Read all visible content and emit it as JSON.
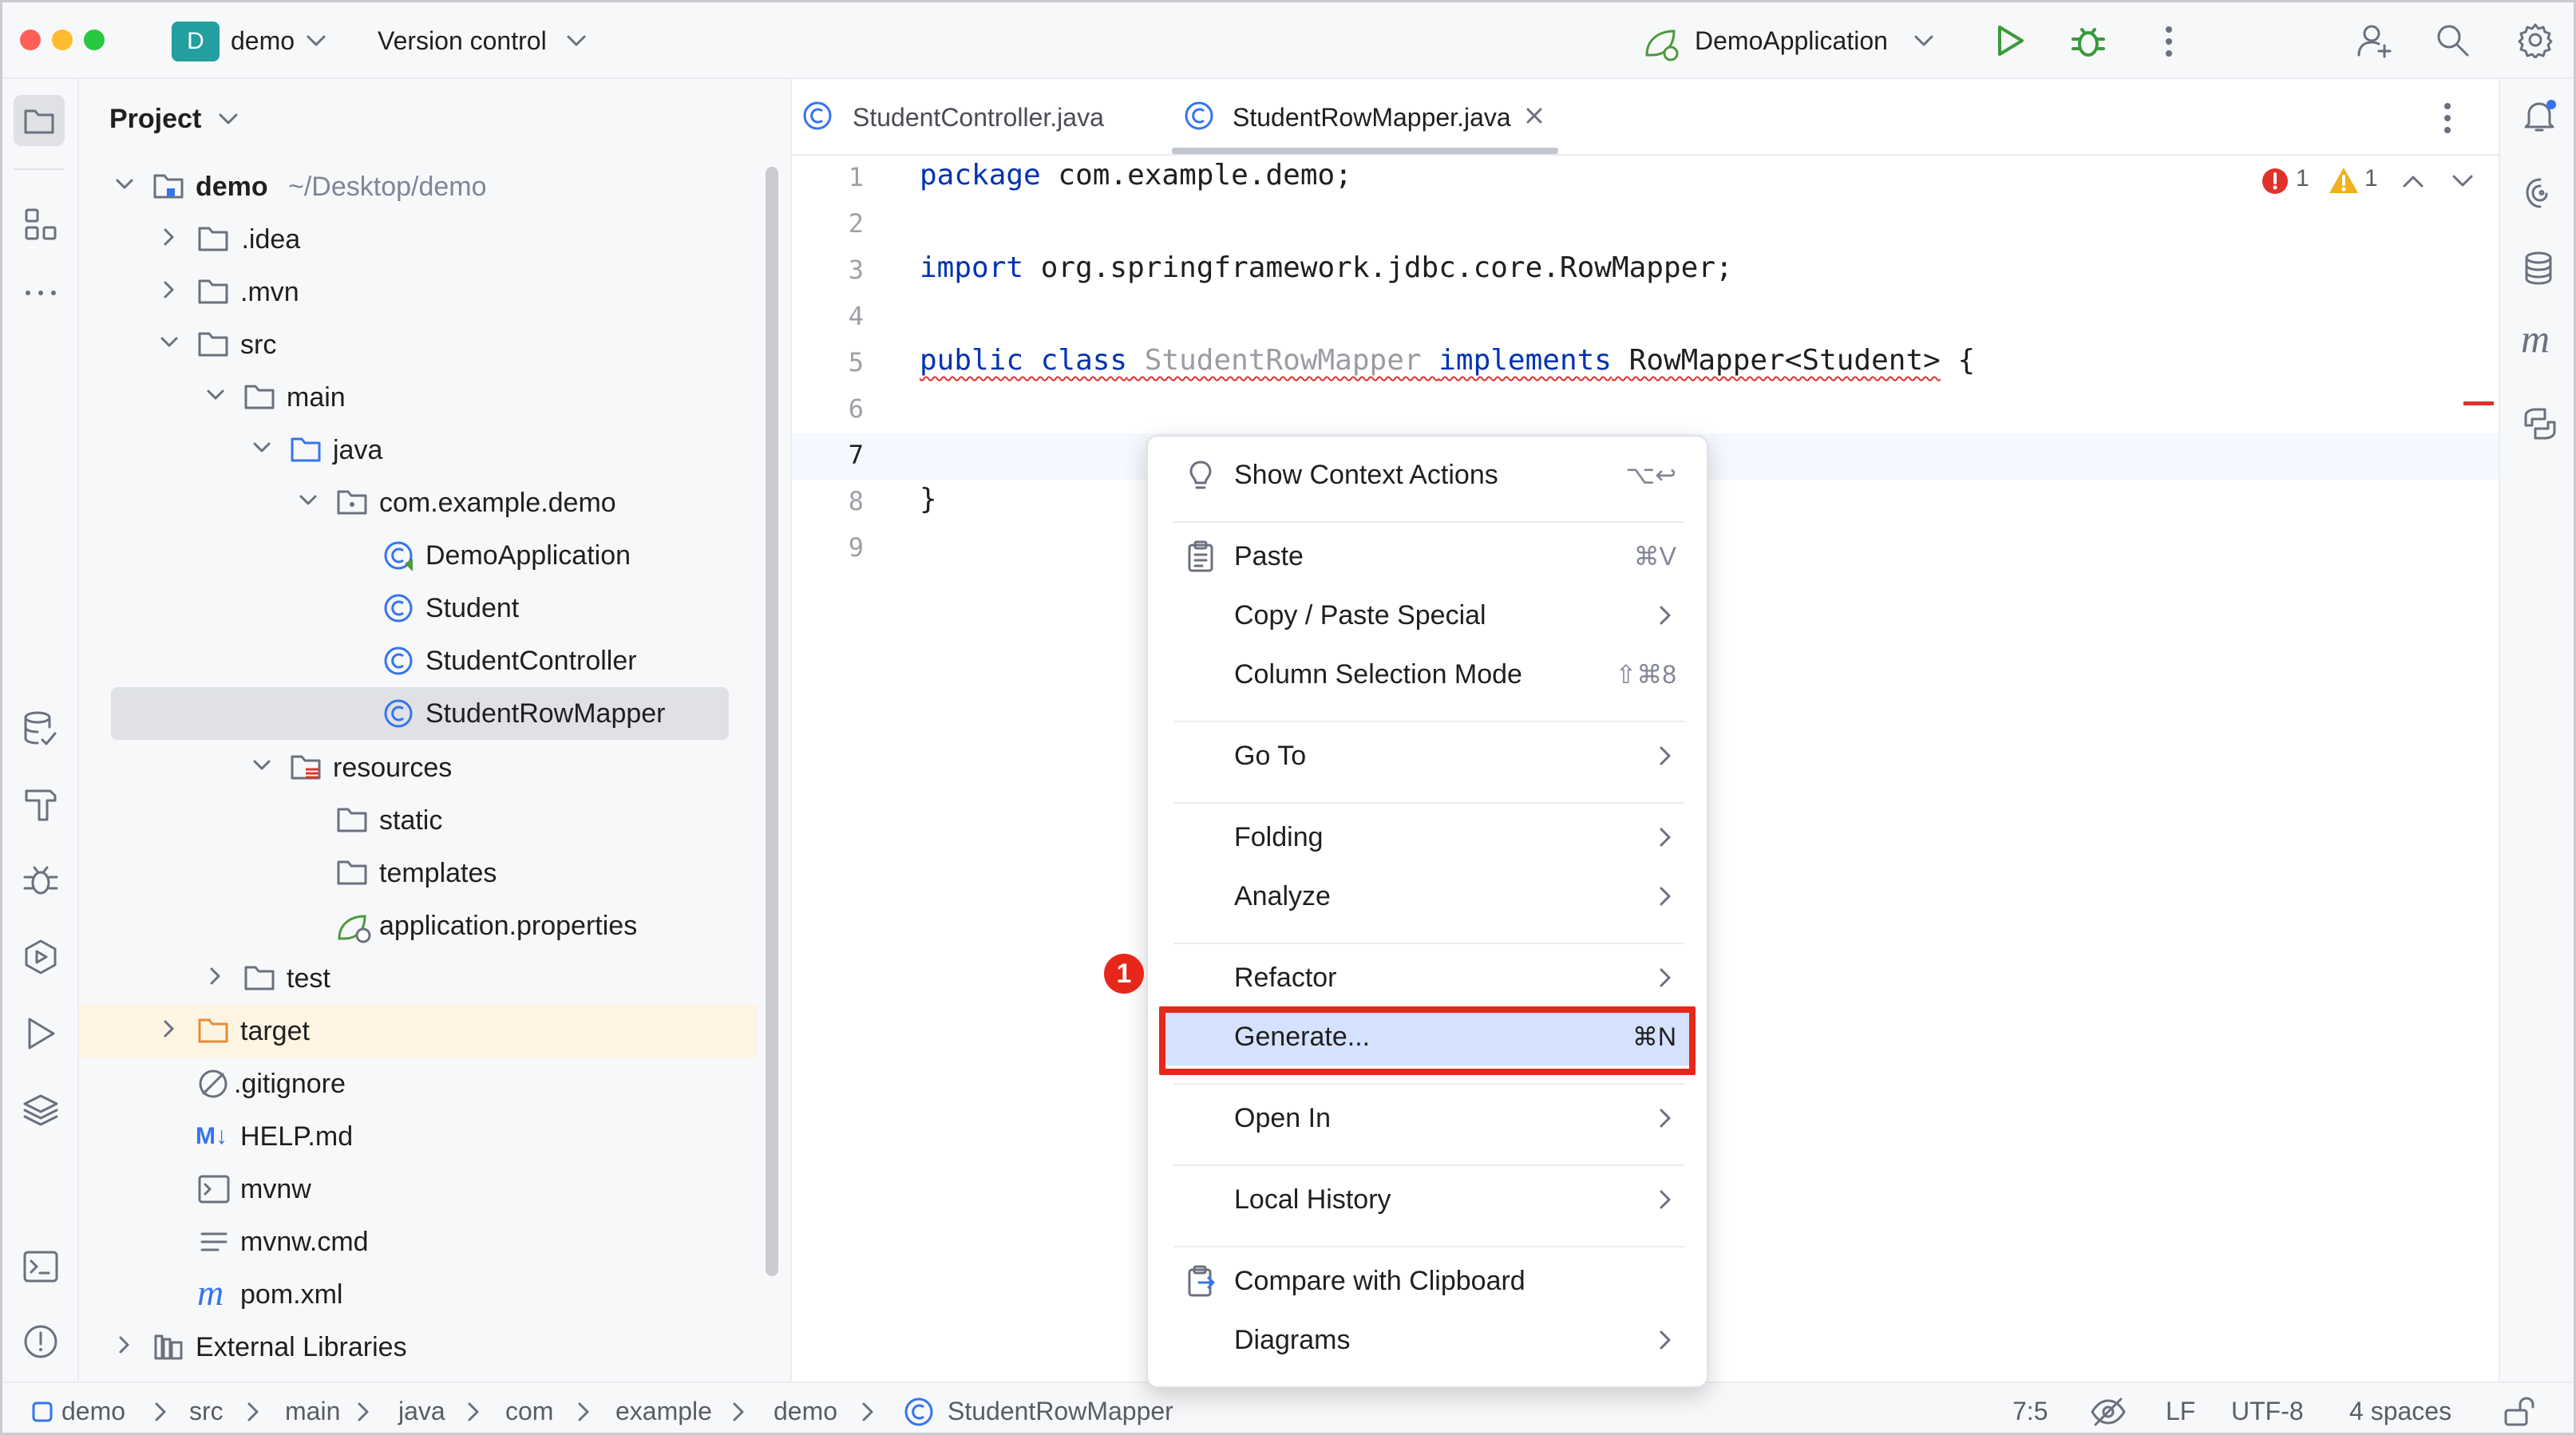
{
  "titlebar": {
    "project_badge": "D",
    "project_name": "demo",
    "vcs_label": "Version control",
    "run_config": "DemoApplication"
  },
  "project_panel": {
    "title": "Project",
    "root_name": "demo",
    "root_path": "~/Desktop/demo",
    "items": [
      {
        "label": " .idea"
      },
      {
        "label": ".mvn"
      },
      {
        "label": "src"
      },
      {
        "label": "main"
      },
      {
        "label": "java"
      },
      {
        "label": "com.example.demo"
      },
      {
        "label": "DemoApplication"
      },
      {
        "label": "Student"
      },
      {
        "label": "StudentController"
      },
      {
        "label": "StudentRowMapper"
      },
      {
        "label": "resources"
      },
      {
        "label": "static"
      },
      {
        "label": "templates"
      },
      {
        "label": "application.properties"
      },
      {
        "label": "test"
      },
      {
        "label": "target"
      },
      {
        "label": ".gitignore"
      },
      {
        "label": "HELP.md"
      },
      {
        "label": "mvnw"
      },
      {
        "label": "mvnw.cmd"
      },
      {
        "label": "pom.xml"
      },
      {
        "label": "External Libraries"
      }
    ]
  },
  "editor": {
    "tabs": [
      {
        "label": "StudentController.java"
      },
      {
        "label": "StudentRowMapper.java"
      }
    ],
    "line_numbers": [
      "1",
      "2",
      "3",
      "4",
      "5",
      "6",
      "7",
      "8",
      "9"
    ],
    "code": {
      "l1_kw": "package",
      "l1_rest": " com.example.demo;",
      "l3_kw": "import",
      "l3_rest": " org.springframework.jdbc.core.RowMapper;",
      "l5_kw1": "public class",
      "l5_name": " StudentRowMapper ",
      "l5_kw2": "implements",
      "l5_rest": " RowMapper<Student>",
      "l5_brace": " {",
      "l8": "}"
    },
    "inspections": {
      "errors": "1",
      "warnings": "1"
    }
  },
  "context_menu": {
    "items": [
      {
        "label": "Show Context Actions",
        "shortcut": "⌥↩"
      },
      {
        "label": "Paste",
        "shortcut": "⌘V"
      },
      {
        "label": "Copy / Paste Special"
      },
      {
        "label": "Column Selection Mode",
        "shortcut": "⇧⌘8"
      },
      {
        "label": "Go To"
      },
      {
        "label": "Folding"
      },
      {
        "label": "Analyze"
      },
      {
        "label": "Refactor"
      },
      {
        "label": "Generate...",
        "shortcut": "⌘N"
      },
      {
        "label": "Open In"
      },
      {
        "label": "Local History"
      },
      {
        "label": "Compare with Clipboard"
      },
      {
        "label": "Diagrams"
      }
    ],
    "step_badge": "1",
    "highlight_color": "#e8271b"
  },
  "statusbar": {
    "breadcrumbs": [
      "demo",
      "src",
      "main",
      "java",
      "com",
      "example",
      "demo",
      "StudentRowMapper"
    ],
    "position": "7:5",
    "line_sep": "LF",
    "encoding": "UTF-8",
    "indent": "4 spaces"
  }
}
